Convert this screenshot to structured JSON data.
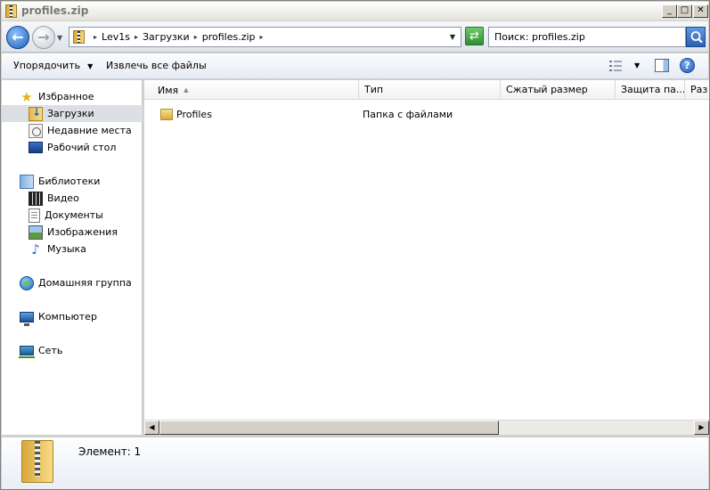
{
  "window": {
    "title": "profiles.zip"
  },
  "address": {
    "crumbs": [
      "Lev1s",
      "Загрузки",
      "profiles.zip"
    ]
  },
  "search": {
    "value": "Поиск: profiles.zip"
  },
  "toolbar": {
    "organize_label": "Упорядочить",
    "extract_label": "Извлечь все файлы"
  },
  "navpane": {
    "favorites": "Избранное",
    "downloads": "Загрузки",
    "recent": "Недавние места",
    "desktop": "Рабочий стол",
    "libraries": "Библиотеки",
    "video": "Видео",
    "documents": "Документы",
    "images": "Изображения",
    "music": "Музыка",
    "homegroup": "Домашняя группа",
    "computer": "Компьютер",
    "network": "Сеть"
  },
  "columns": {
    "name": "Имя",
    "type": "Тип",
    "compressed": "Сжатый размер",
    "protect": "Защита па...",
    "size": "Раз"
  },
  "files": [
    {
      "name": "Profiles",
      "type": "Папка с файлами"
    }
  ],
  "details": {
    "count": "Элемент: 1"
  }
}
